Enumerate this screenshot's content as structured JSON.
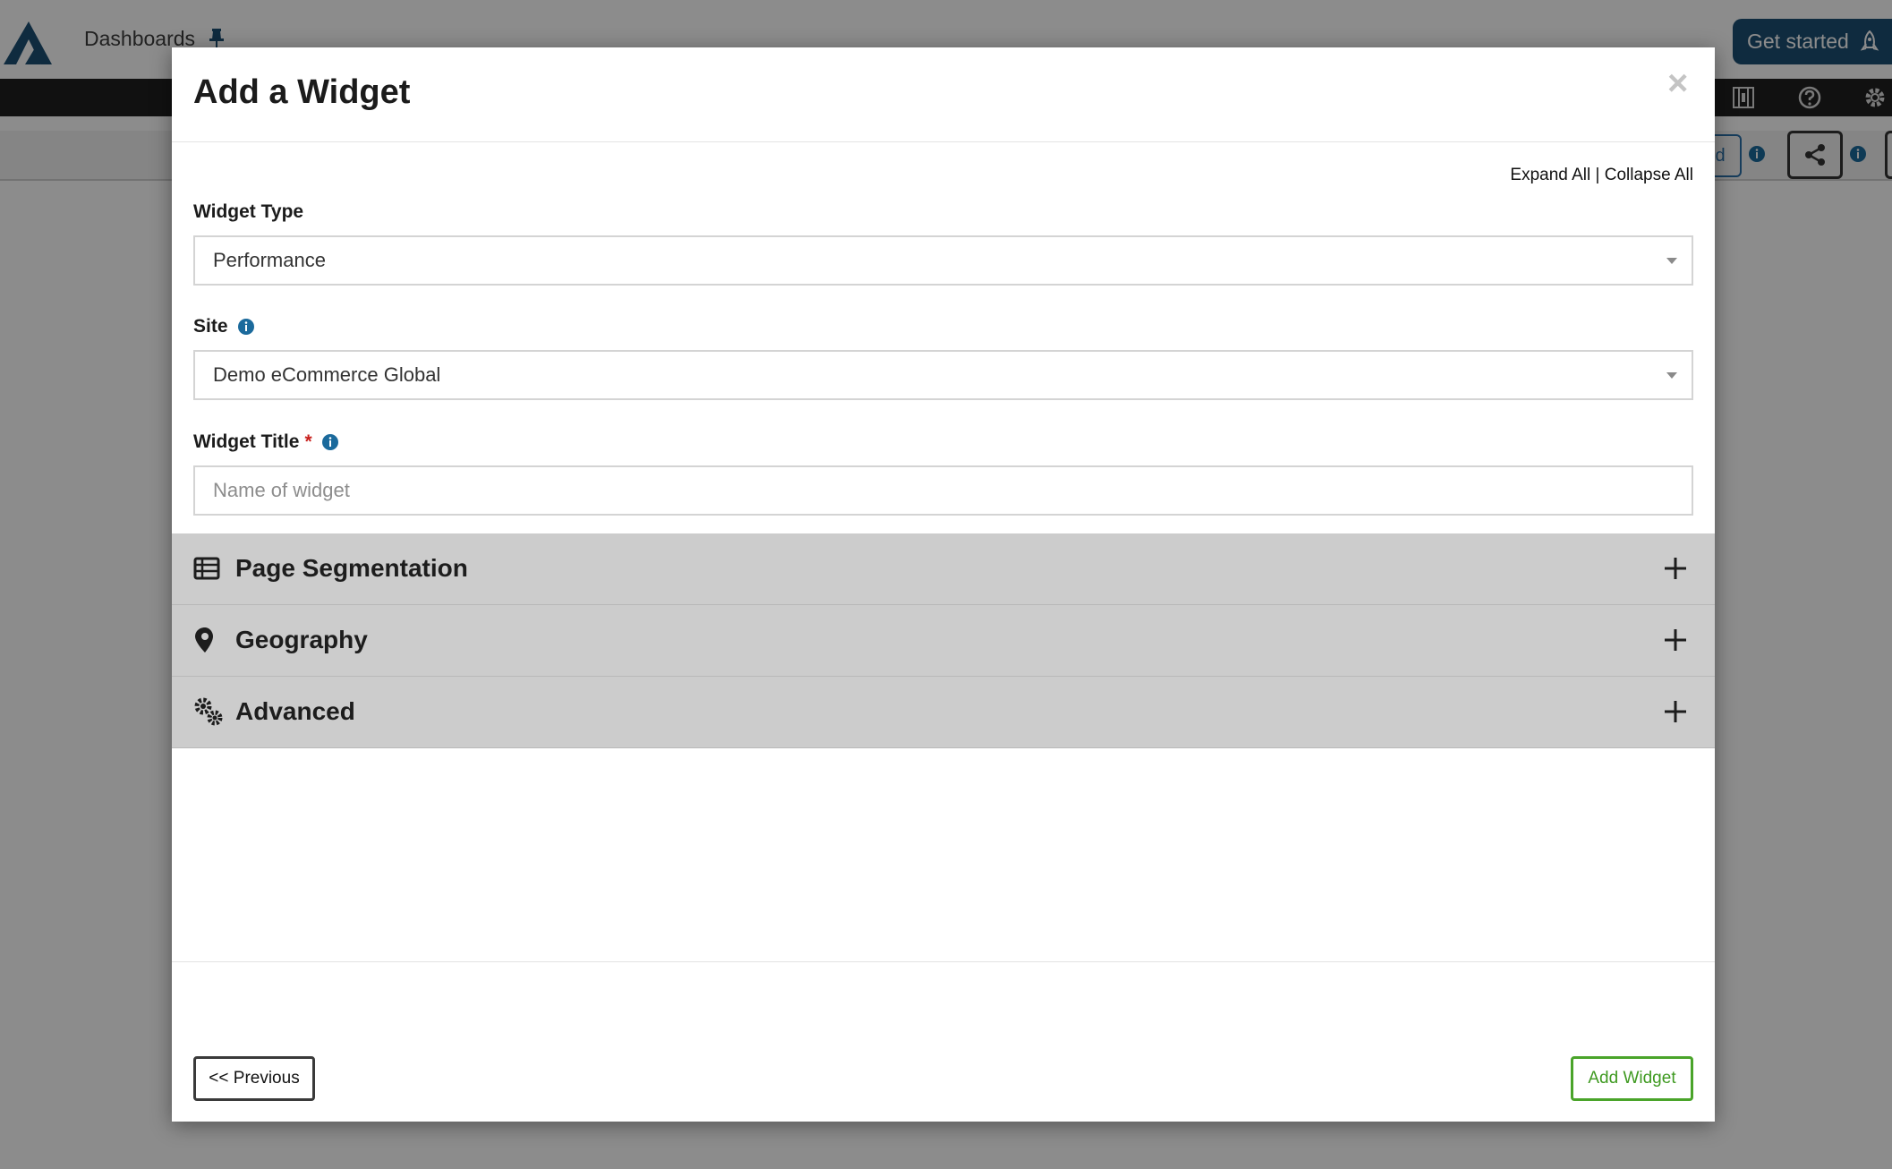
{
  "background": {
    "breadcrumb": "Dashboards",
    "get_started_label": "Get started",
    "partial_button_text": "d",
    "icons": [
      "logo-icon",
      "pin-icon",
      "rocket-icon",
      "video-library-icon",
      "help-icon",
      "settings-icon",
      "info-icon",
      "share-icon"
    ]
  },
  "modal": {
    "title": "Add a Widget",
    "close_glyph": "×",
    "expand_all": "Expand All",
    "separator": "|",
    "collapse_all": "Collapse All",
    "widget_type": {
      "label": "Widget Type",
      "value": "Performance"
    },
    "site": {
      "label": "Site",
      "value": "Demo eCommerce Global"
    },
    "widget_title": {
      "label": "Widget Title",
      "required_mark": "*",
      "value": "",
      "placeholder": "Name of widget"
    },
    "sections": [
      {
        "label": "Page Segmentation",
        "icon": "table-list-icon"
      },
      {
        "label": "Geography",
        "icon": "map-marker-icon"
      },
      {
        "label": "Advanced",
        "icon": "gears-icon"
      }
    ],
    "previous_label": "<< Previous",
    "add_label": "Add Widget"
  },
  "colors": {
    "brand": "#1d4f73",
    "info_blue": "#1b6a9c",
    "required_red": "#c8201d",
    "add_green": "#4aa42a",
    "section_bg": "#cccccc"
  }
}
